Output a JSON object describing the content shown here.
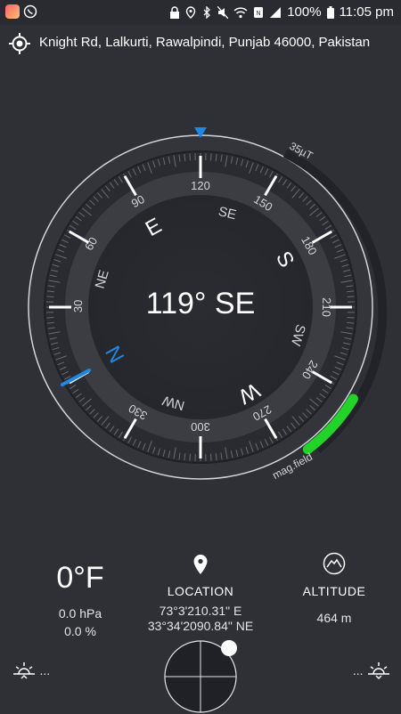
{
  "status_bar": {
    "battery_percent": "100%",
    "time": "11:05 pm",
    "icons": [
      "photo-app-icon",
      "whatsapp-icon",
      "lock-icon",
      "location-pin-icon",
      "bluetooth-icon",
      "mute-icon",
      "wifi-icon",
      "nfc-icon",
      "signal-icon",
      "battery-icon"
    ]
  },
  "address": {
    "text": "Knight Rd, Lalkurti, Rawalpindi, Punjab 46000, Pakistan",
    "icon": "gps-target-icon"
  },
  "compass": {
    "heading_text": "119° SE",
    "heading_degrees": 119,
    "inner_labels": [
      "90",
      "120",
      "150",
      "180",
      "210",
      "240",
      "270",
      "300",
      "330",
      "30",
      "60"
    ],
    "cardinals": [
      "E",
      "SE",
      "S",
      "SW",
      "W",
      "NW",
      "N",
      "NE"
    ],
    "magnetic_field": {
      "max_label": "35µT",
      "label": "mag.field",
      "level_fraction": 0.2
    },
    "colors": {
      "accent_blue": "#1e88e5",
      "mag_green": "#22d32a",
      "background": "#2f3036"
    }
  },
  "temperature": {
    "value": "0°F",
    "pressure": "0.0 hPa",
    "humidity": "0.0 %"
  },
  "location": {
    "title": "LOCATION",
    "longitude": "73°3'210.31\" E",
    "latitude": "33°34'2090.84\" NE",
    "icon": "map-pin-icon"
  },
  "altitude": {
    "title": "ALTITUDE",
    "value": "464 m",
    "icon": "mountain-icon"
  },
  "bottom": {
    "left_dots": "...",
    "right_dots": "...",
    "left_icon": "sunrise-icon",
    "right_icon": "sunset-icon"
  }
}
